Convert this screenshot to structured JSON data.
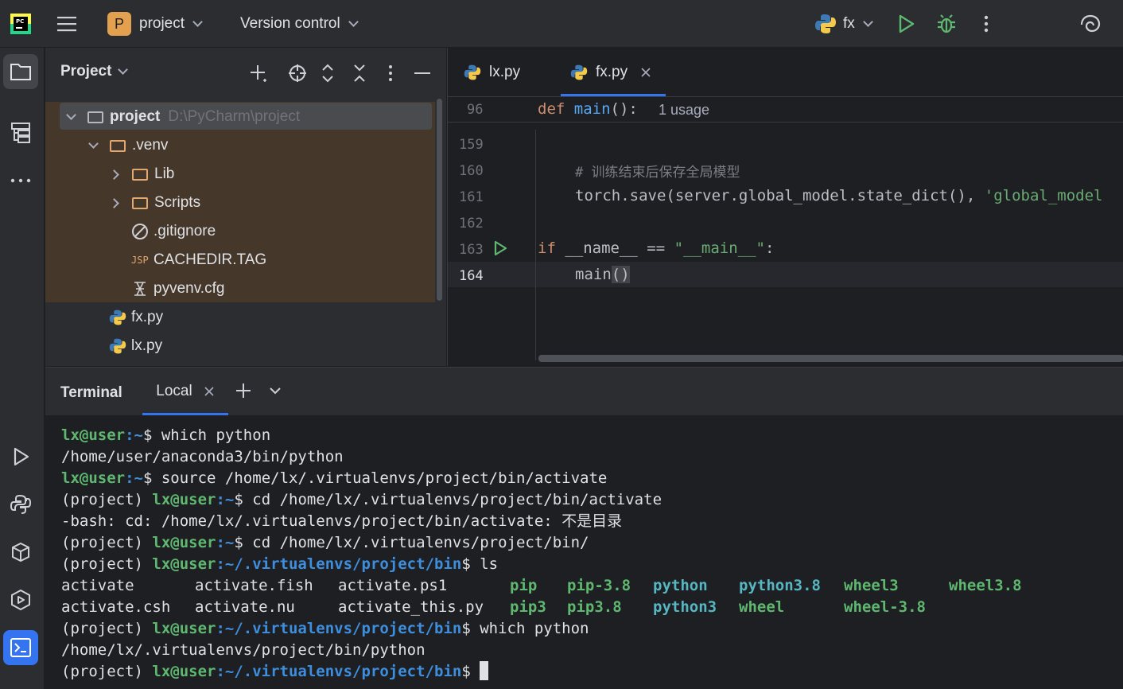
{
  "topbar": {
    "project_badge": "P",
    "project_name": "project",
    "vcs": "Version control",
    "run_config": "fx"
  },
  "project_panel": {
    "title": "Project",
    "root_name": "project",
    "root_path": "D:\\PyCharm\\project",
    "venv": ".venv",
    "lib": "Lib",
    "scripts": "Scripts",
    "gitignore": ".gitignore",
    "cachedir": "CACHEDIR.TAG",
    "cachedir_icon": "JSP",
    "pyvenv": "pyvenv.cfg",
    "fx": "fx.py",
    "lx": "lx.py"
  },
  "editor": {
    "tabs": [
      "lx.py",
      "fx.py"
    ],
    "sticky_line": "96",
    "sticky_def": "def",
    "sticky_fn": "main",
    "sticky_rest": "():",
    "usage": "1 usage",
    "lines": [
      "159",
      "160",
      "161",
      "162",
      "163",
      "164"
    ],
    "comment": "# 训练结束后保存全局模型",
    "save_call": "torch.save(server.global_model.state_dict(), ",
    "save_str": "'global_model",
    "if_kw": "if",
    "if_mid": " __name__ == ",
    "if_str": "\"__main__\"",
    "if_end": ":",
    "main_call": "main",
    "main_parens": "()"
  },
  "terminal": {
    "title": "Terminal",
    "tab": "Local",
    "user": "lx@user",
    "venv_prefix": "(project) ",
    "path_home": ":~",
    "path_bin": ":~/.virtualenvs/project/bin",
    "cmd1": "which python",
    "out1": "/home/user/anaconda3/bin/python",
    "cmd2": "source /home/lx/.virtualenvs/project/bin/activate",
    "cmd3": "cd /home/lx/.virtualenvs/project/bin/activate",
    "out3": "-bash: cd: /home/lx/.virtualenvs/project/bin/activate: 不是目录",
    "cmd4": "cd /home/lx/.virtualenvs/project/bin/",
    "cmd5": "ls",
    "ls_plain1": [
      "activate",
      "activate.fish",
      "activate.ps1"
    ],
    "ls_plain2": [
      "activate.csh",
      "activate.nu",
      "activate_this.py"
    ],
    "ls_exec1": [
      "pip",
      "pip-3.8",
      "python",
      "python3.8",
      "wheel3",
      "wheel3.8"
    ],
    "ls_exec2": [
      "pip3",
      "pip3.8",
      "python3",
      "wheel",
      "wheel-3.8"
    ],
    "cmd6": "which python",
    "out6": "/home/lx/.virtualenvs/project/bin/python"
  }
}
